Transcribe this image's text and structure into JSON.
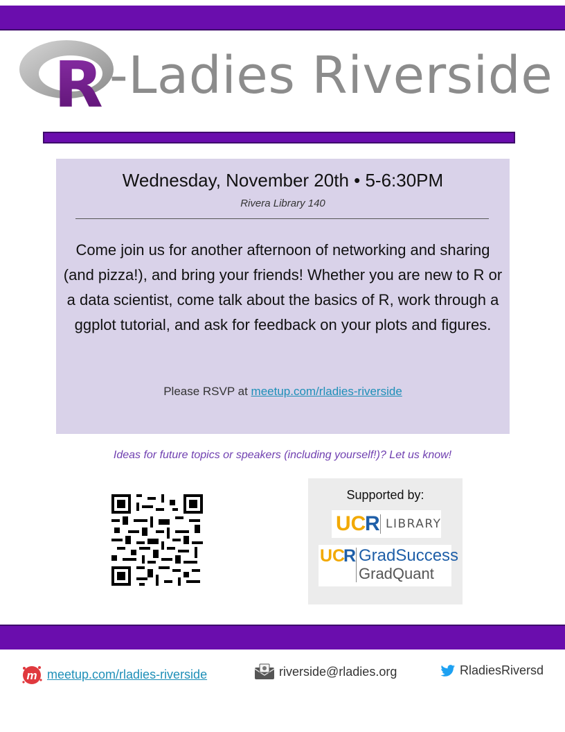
{
  "header": {
    "logo_text": "R",
    "title": "-Ladies Riverside"
  },
  "event": {
    "date_time": "Wednesday, November 20th • 5-6:30PM",
    "location": "Rivera Library 140",
    "description": "Come join us for another afternoon of networking and sharing (and pizza!), and bring your friends! Whether you are new to R or a data scientist, come talk about the basics of R, work through a ggplot tutorial, and ask for feedback on your plots and figures.",
    "rsvp_prefix": "Please RSVP at ",
    "rsvp_link": "meetup.com/rladies-riverside"
  },
  "ideas_text": "Ideas for future topics or speakers (including yourself!)? Let us know!",
  "support": {
    "label": "Supported by:",
    "library_ucr": "UC",
    "library_r": "R",
    "library_name": "LIBRARY",
    "grad_ucr": "UC",
    "grad_r": "R",
    "grad_line1": "GradSuccess",
    "grad_line2": "GradQuant"
  },
  "footer": {
    "meetup_link": "meetup.com/rladies-riverside",
    "email": "riverside@rladies.org",
    "twitter": "RladiesRiversd"
  },
  "colors": {
    "brand_purple": "#6a0dad",
    "box_lavender": "#d9d2e9",
    "link_blue": "#1e8fb8",
    "ucr_gold": "#f2a900",
    "ucr_blue": "#1f5fa8"
  },
  "icons": {
    "meetup": "meetup-icon",
    "email": "email-icon",
    "twitter": "twitter-bird-icon"
  }
}
